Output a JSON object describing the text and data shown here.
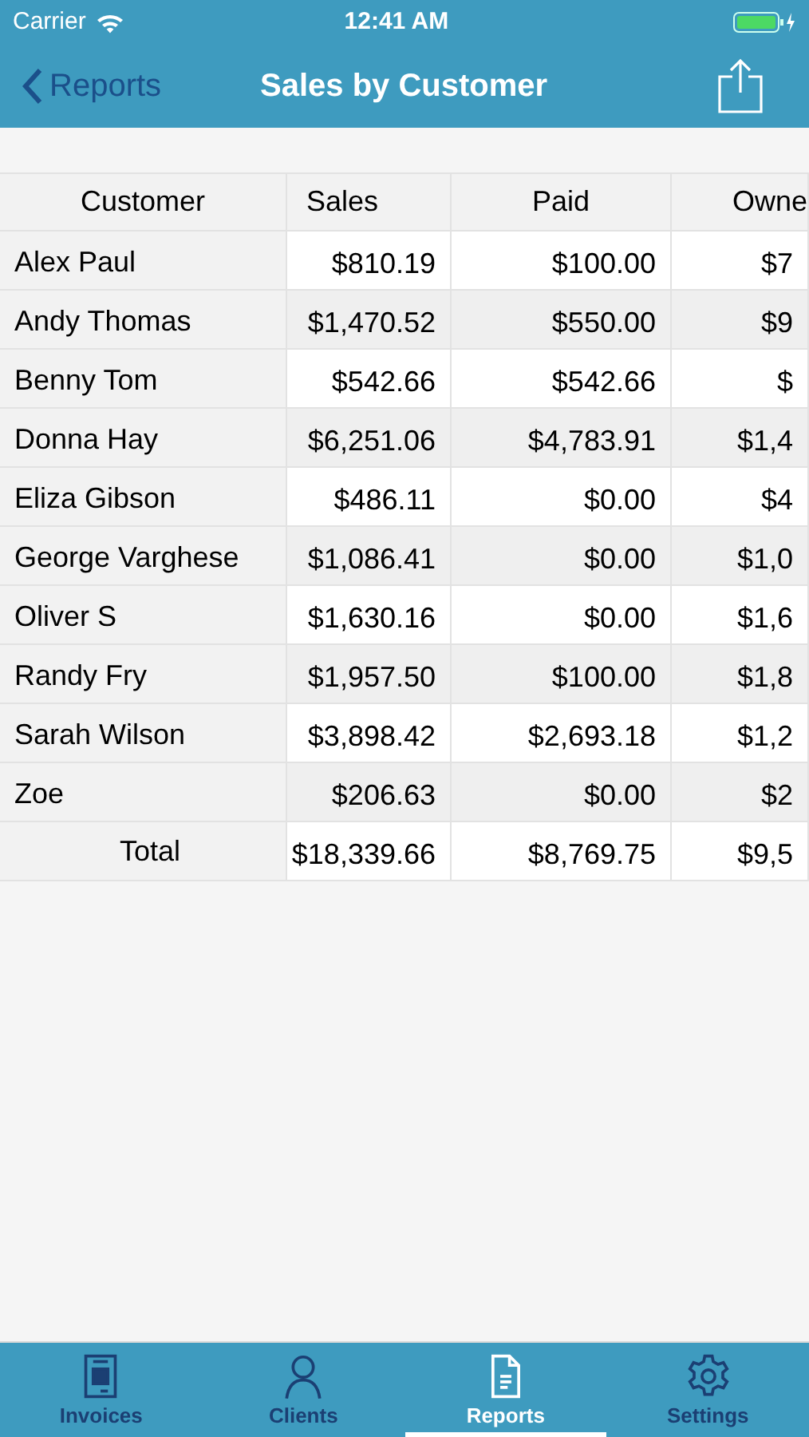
{
  "status_bar": {
    "carrier": "Carrier",
    "time": "12:41 AM"
  },
  "nav": {
    "back": "Reports",
    "title": "Sales by Customer"
  },
  "table": {
    "columns": [
      "Customer",
      "Sales",
      "Paid",
      "Owne"
    ],
    "rows": [
      [
        "Alex Paul",
        "$810.19",
        "$100.00",
        "$7"
      ],
      [
        "Andy Thomas",
        "$1,470.52",
        "$550.00",
        "$9"
      ],
      [
        "Benny Tom",
        "$542.66",
        "$542.66",
        "$"
      ],
      [
        "Donna Hay",
        "$6,251.06",
        "$4,783.91",
        "$1,4"
      ],
      [
        "Eliza Gibson",
        "$486.11",
        "$0.00",
        "$4"
      ],
      [
        "George Varghese",
        "$1,086.41",
        "$0.00",
        "$1,0"
      ],
      [
        "Oliver S",
        "$1,630.16",
        "$0.00",
        "$1,6"
      ],
      [
        "Randy Fry",
        "$1,957.50",
        "$100.00",
        "$1,8"
      ],
      [
        "Sarah Wilson",
        "$3,898.42",
        "$2,693.18",
        "$1,2"
      ],
      [
        "Zoe",
        "$206.63",
        "$0.00",
        "$2"
      ]
    ],
    "total": [
      "Total",
      "$18,339.66",
      "$8,769.75",
      "$9,5"
    ]
  },
  "tab_bar": [
    {
      "label": "Invoices",
      "kind": "invoices",
      "selected": false
    },
    {
      "label": "Clients",
      "kind": "clients",
      "selected": false
    },
    {
      "label": "Reports",
      "kind": "reports",
      "selected": true
    },
    {
      "label": "Settings",
      "kind": "settings",
      "selected": false
    }
  ]
}
